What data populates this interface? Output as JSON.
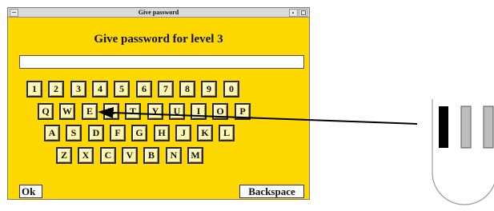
{
  "window": {
    "title": "Give password"
  },
  "dialog": {
    "heading": "Give password for level 3",
    "password_value": ""
  },
  "keyboard": {
    "row1": [
      "1",
      "2",
      "3",
      "4",
      "5",
      "6",
      "7",
      "8",
      "9",
      "0"
    ],
    "row2": [
      "Q",
      "W",
      "E",
      "R",
      "T",
      "Y",
      "U",
      "I",
      "O",
      "P"
    ],
    "row3": [
      "A",
      "S",
      "D",
      "F",
      "G",
      "H",
      "J",
      "K",
      "L"
    ],
    "row4": [
      "Z",
      "X",
      "C",
      "V",
      "B",
      "N",
      "M"
    ]
  },
  "buttons": {
    "ok": "Ok",
    "backspace": "Backspace"
  },
  "colors": {
    "panel": "#ffd800",
    "key_face": "#fff7b0",
    "arrow": "#000000"
  },
  "icons": {
    "pointer_device": "stylus-tip-icon",
    "pointer_arrow": "arrow-left-icon"
  }
}
